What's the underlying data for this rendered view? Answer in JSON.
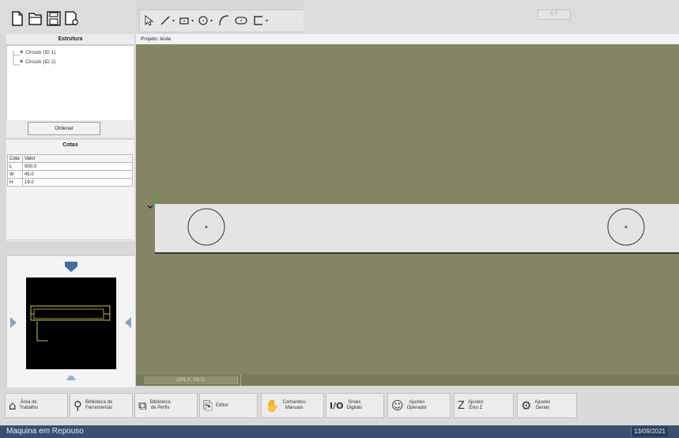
{
  "toolbar": {
    "file_buttons": [
      {
        "name": "new-file-icon"
      },
      {
        "name": "open-folder-icon"
      },
      {
        "name": "save-icon"
      },
      {
        "name": "settings-document-icon"
      }
    ],
    "draw_tools": [
      {
        "name": "select-pointer-icon"
      },
      {
        "name": "line-tool-icon"
      },
      {
        "name": "rectangle-tool-icon"
      },
      {
        "name": "circle-tool-icon"
      },
      {
        "name": "arc-tool-icon"
      },
      {
        "name": "slot-tool-icon"
      },
      {
        "name": "profile-tool-icon"
      }
    ],
    "xy_indicator": "X:Y"
  },
  "estrutura": {
    "title": "Estrutura",
    "items": [
      "Circulo (ID 1)",
      "Circulo (ID 2)"
    ],
    "ordenar_label": "Ordenar"
  },
  "cotas": {
    "title": "Cotas",
    "columns": [
      "Cota",
      "Valor"
    ],
    "rows": [
      {
        "cota": "L",
        "valor": "500.0"
      },
      {
        "cota": "W",
        "valor": "45.0"
      },
      {
        "cota": "H",
        "valor": "19.0"
      }
    ]
  },
  "project": {
    "label": "Projeto: teste"
  },
  "canvas": {
    "coords_readout": "(201.4 , 63.2)"
  },
  "bottom_buttons": [
    {
      "name": "area-trabalho-button",
      "icon": "⌂",
      "label": "Área de\nTrabalho"
    },
    {
      "name": "biblioteca-ferramentas-button",
      "icon": "⚲",
      "label": "Biblioteca de\nFerramentas"
    },
    {
      "name": "biblioteca-perfis-button",
      "icon": "⧉",
      "label": "Biblioteca\nde Perfis"
    },
    {
      "name": "editor-button",
      "icon": "⎘",
      "label": "Editor"
    },
    {
      "name": "comandos-manuais-button",
      "icon": "✋",
      "label": "Comandos\nManuais"
    },
    {
      "name": "sinais-digitais-button",
      "icon": "I/O",
      "label": "Sinais\nDigitais"
    },
    {
      "name": "ajustes-operador-button",
      "icon": "☺",
      "label": "Ajustes\nOperador"
    },
    {
      "name": "ajustes-eixo-z-button",
      "icon": "Z",
      "label": "Ajustes\nEixo Z"
    },
    {
      "name": "ajustes-gerais-button",
      "icon": "⚙",
      "label": "Ajustes\nGerais"
    }
  ],
  "status": {
    "message": "Maquina em Repouso",
    "date": "13/09/2021"
  },
  "colors": {
    "canvas_bg": "#858565",
    "statusbar_bg": "#3a4f72",
    "piece_fill": "#e4e4e4"
  }
}
